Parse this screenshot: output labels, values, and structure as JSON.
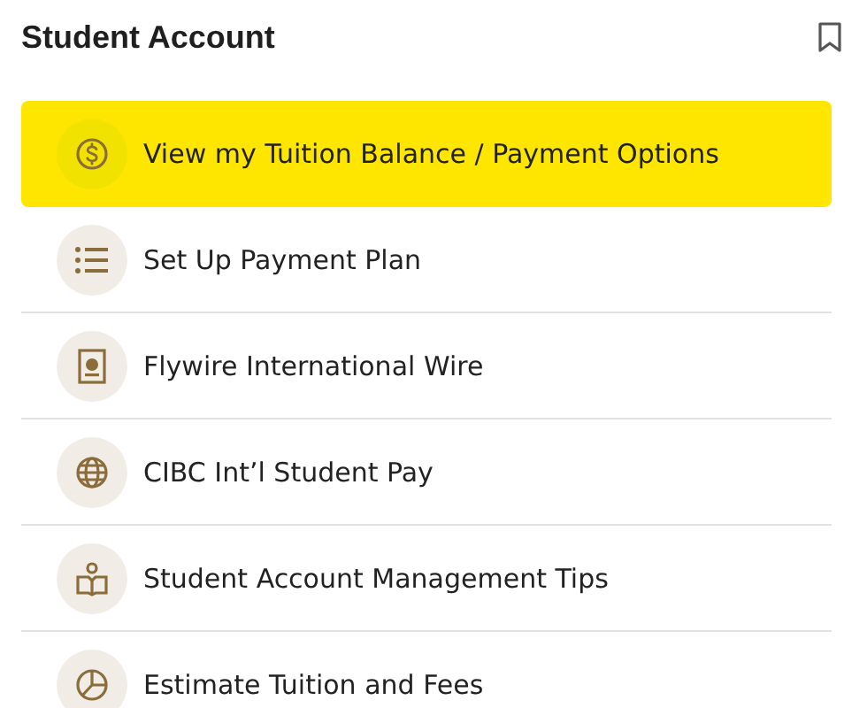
{
  "title": "Student Account",
  "items": [
    {
      "label": "View my Tuition Balance / Payment Options",
      "kind": "dollar",
      "highlighted": true
    },
    {
      "label": "Set Up Payment Plan",
      "kind": "list",
      "highlighted": false
    },
    {
      "label": "Flywire International Wire",
      "kind": "card",
      "highlighted": false
    },
    {
      "label": "CIBC Int’l Student Pay",
      "kind": "globe",
      "highlighted": false
    },
    {
      "label": "Student Account Management Tips",
      "kind": "book",
      "highlighted": false
    },
    {
      "label": "Estimate Tuition and Fees",
      "kind": "pie",
      "highlighted": false
    }
  ]
}
